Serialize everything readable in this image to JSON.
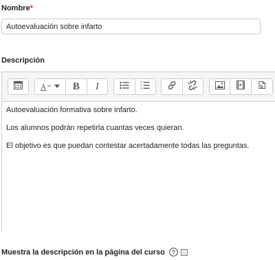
{
  "name_field": {
    "label": "Nombre",
    "required_marker": "*",
    "value": "Autoevaluación sobre infarto"
  },
  "description": {
    "label": "Descripción",
    "toolbar": {
      "buttons": [
        {
          "name": "toggle-toolbar-icon"
        },
        {
          "name": "font-style-icon",
          "text": "A"
        },
        {
          "name": "bold-button",
          "text": "B"
        },
        {
          "name": "italic-button",
          "text": "I"
        },
        {
          "name": "unordered-list-icon"
        },
        {
          "name": "ordered-list-icon"
        },
        {
          "name": "link-icon"
        },
        {
          "name": "unlink-icon"
        },
        {
          "name": "image-icon"
        },
        {
          "name": "media-icon"
        },
        {
          "name": "file-manager-icon"
        }
      ]
    },
    "paragraphs": [
      "Autoevaluación formativa sobre infarto.",
      "Los alumnos podrán repetirla cuantas veces quieran.",
      "El objetivo es que puedan contestar acertadamente todas las preguntas."
    ]
  },
  "show_description": {
    "label": "Muestra la descripción en la página del curso",
    "help_icon": "help-icon",
    "checked": false
  }
}
